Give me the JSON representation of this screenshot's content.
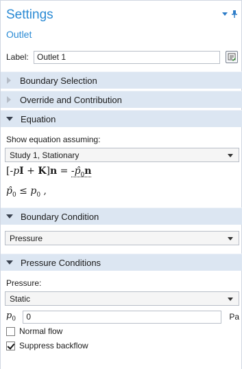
{
  "header": {
    "title": "Settings",
    "subtitle": "Outlet"
  },
  "label_row": {
    "label": "Label:",
    "value": "Outlet 1"
  },
  "sections": {
    "boundary_selection": "Boundary Selection",
    "override": "Override and Contribution",
    "equation": "Equation",
    "boundary_condition": "Boundary Condition",
    "pressure_conditions": "Pressure Conditions"
  },
  "equation": {
    "show_label": "Show equation assuming:",
    "study": "Study 1, Stationary",
    "line1": {
      "open": "[",
      "minus_p": "-p",
      "I": "I",
      "plus": " + ",
      "K": "K",
      "close": "]",
      "n": "n",
      "eq": " = ",
      "rhs": "-p̂",
      "sub0": "0",
      "n2": "n"
    },
    "line2": {
      "p_hat": "p̂",
      "sub0": "0",
      "leq": " ≤ ",
      "p": "p",
      "sub0b": "0",
      "comma": " ,"
    }
  },
  "boundary_condition": {
    "value": "Pressure"
  },
  "pressure_conditions": {
    "pressure_label": "Pressure:",
    "pressure_type": "Static",
    "p0_symbol": "p",
    "p0_sub": "0",
    "p0_value": "0",
    "p0_unit": "Pa",
    "normal_flow": {
      "label": "Normal flow",
      "checked": false
    },
    "suppress_backflow": {
      "label": "Suppress backflow",
      "checked": true
    }
  },
  "colors": {
    "title": "#2a8ad4",
    "section_bg": "#dce6f2"
  }
}
